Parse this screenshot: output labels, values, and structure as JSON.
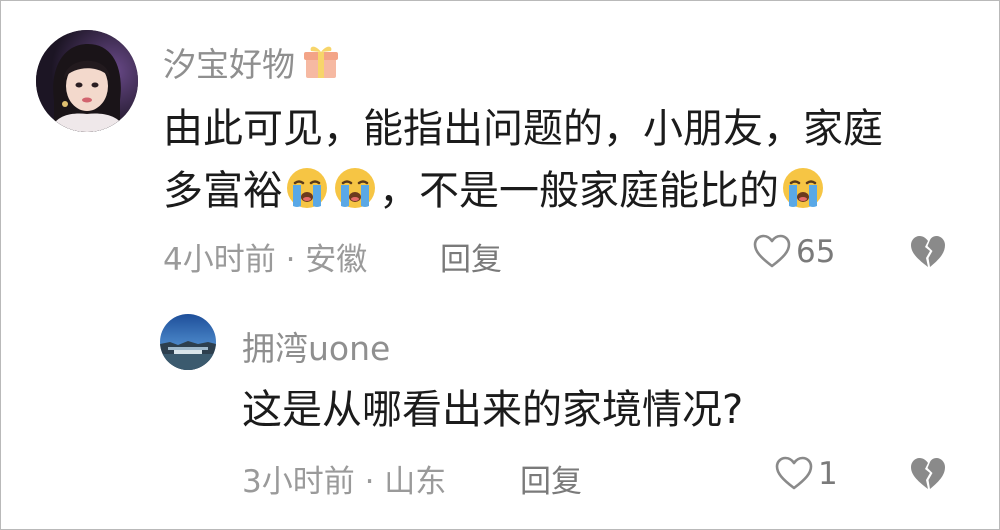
{
  "comment": {
    "username": "汐宝好物",
    "badge_icon": "gift-icon",
    "text_line1": "由此可见，能指出问题的，小朋友，家庭",
    "text_line2_part1": "多富裕",
    "text_line2_part2": "，不是一般家庭能比的",
    "emoji_icon": "loudly-crying-face-icon",
    "time_location": "4小时前 · 安徽",
    "reply_label": "回复",
    "like_count": "65"
  },
  "reply": {
    "username": "拥湾uone",
    "text": "这是从哪看出来的家境情况?",
    "time_location": "3小时前 · 山东",
    "reply_label": "回复",
    "like_count": "1"
  },
  "colors": {
    "username": "#8f8f8f",
    "meta": "#9a9a9a",
    "text": "#1b1b1b",
    "icon": "#8a8a8a",
    "emoji_face": "#f6c544",
    "emoji_tears": "#5aa8e6"
  }
}
